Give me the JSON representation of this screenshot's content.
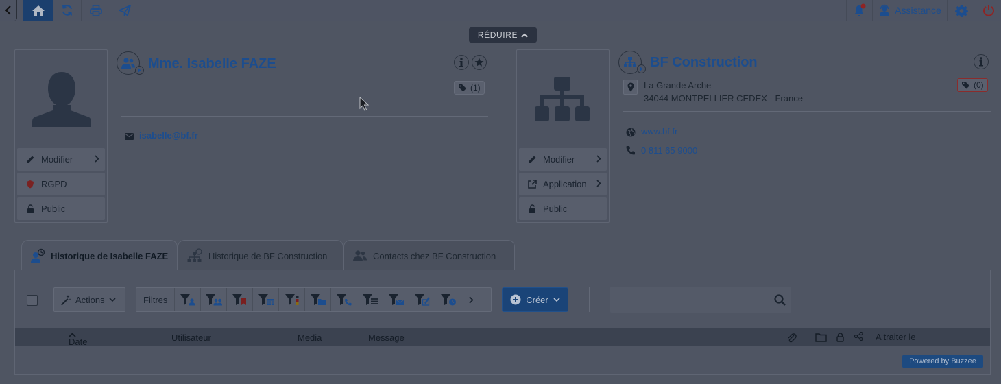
{
  "topbar": {
    "assistance_label": "Assistance",
    "icons": [
      "back-icon",
      "home-icon",
      "refresh-icon",
      "print-icon",
      "send-icon",
      "bell-icon",
      "headset-icon",
      "gear-icon",
      "power-icon"
    ]
  },
  "reduce_label": "RÉDUIRE",
  "contact": {
    "name": "Mme. Isabelle FAZE",
    "email": "isabelle@bf.fr",
    "tag_count": "(1)",
    "side_buttons": [
      "Modifier",
      "RGPD",
      "Public"
    ]
  },
  "company": {
    "name": "BF Construction",
    "address_line1": "La Grande Arche",
    "address_line2": "34044 MONTPELLIER CEDEX - France",
    "website": "www.bf.fr",
    "phone": "0 811 65 9000",
    "tag_count": "(0)",
    "side_buttons": [
      "Modifier",
      "Application",
      "Public"
    ]
  },
  "tabs": [
    "Historique de Isabelle FAZE",
    "Historique de BF Construction",
    "Contacts chez BF Construction"
  ],
  "toolbar": {
    "actions_label": "Actions",
    "filters_label": "Filtres",
    "create_label": "Créer"
  },
  "table": {
    "columns": [
      "Date",
      "Utilisateur",
      "Media",
      "Message",
      "A traiter le"
    ]
  },
  "footer": {
    "powered_label": "Powered by Buzzee"
  },
  "colors": {
    "accent": "#1c4d8e",
    "background": "#4f5562",
    "header": "#3b4250"
  }
}
